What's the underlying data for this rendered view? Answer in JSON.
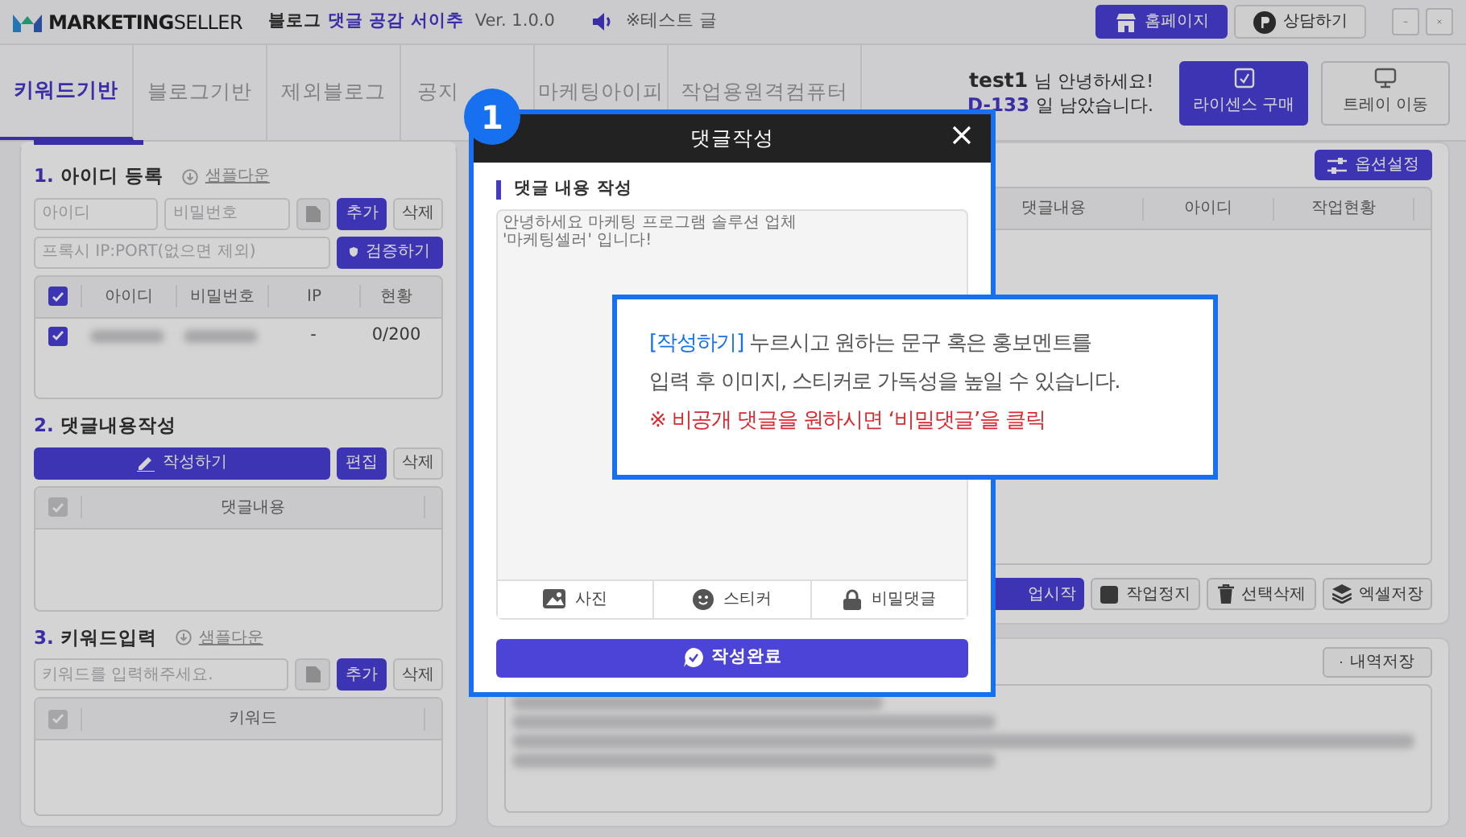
{
  "app": {
    "logo": "**MARKETING**SELLER",
    "product_prefix": "블로그",
    "product_name": "댓글 공감 서이추",
    "version": "Ver. 1.0.0",
    "notice": "※테스트 글"
  },
  "header_buttons": [
    {
      "label": "홈페이지",
      "kind": "home"
    },
    {
      "label": "상담하기",
      "kind": "chat"
    }
  ],
  "tabs": [
    {
      "label": "키워드기반",
      "selected": true
    },
    {
      "label": "블로그기반",
      "selected": false
    },
    {
      "label": "제외블로그",
      "selected": false
    },
    {
      "label": "공지",
      "selected": false
    },
    {
      "label": "마케팅아이피",
      "selected": false
    },
    {
      "label": "작업용원격컴퓨터",
      "selected": false
    }
  ],
  "user": {
    "name": "test1",
    "greeting": "님 안녕하세요!",
    "days": "D-133",
    "days_suffix": "일 남았습니다."
  },
  "side_buttons": [
    {
      "label": "라이센스 구매",
      "kind": "license"
    },
    {
      "label": "트레이 이동",
      "kind": "tray"
    }
  ],
  "account_section": {
    "number": "1.",
    "title": "아이디 등록",
    "link": "샘플다운",
    "id_placeholder": "아이디",
    "password_placeholder": "비밀번호",
    "add": "추가",
    "delete": "삭제",
    "proxy_placeholder": "프록시 IP:PORT(없으면 제외)",
    "verify": "검증하기",
    "header_checked": true,
    "columns": [
      "아이디",
      "비밀번호",
      "IP",
      "현황"
    ],
    "rows": [
      {
        "checked": true,
        "ip": "-",
        "status": "0/200"
      }
    ]
  },
  "comment_section": {
    "number": "2.",
    "title": "댓글내용작성",
    "write": "작성하기",
    "edit": "편집",
    "delete": "삭제",
    "header_checked": true,
    "column": "댓글내용"
  },
  "keyword_section": {
    "number": "3.",
    "title": "키워드입력",
    "link": "샘플다운",
    "placeholder": "키워드를 입력해주세요.",
    "add": "추가",
    "delete": "삭제",
    "header_checked": true,
    "column": "키워드"
  },
  "task_panel": {
    "options": "옵션설정",
    "columns": [
      "댓글내용",
      "아이디",
      "작업현황"
    ],
    "actions": [
      {
        "label": "업시작",
        "kind": "start"
      },
      {
        "label": "작업정지",
        "kind": "stop"
      },
      {
        "label": "선택삭제",
        "kind": "trash"
      },
      {
        "label": "엑셀저장",
        "kind": "excel"
      }
    ]
  },
  "log_panel": {
    "save": "내역저장"
  },
  "modal": {
    "title": "댓글작성",
    "section": "댓글 내용 작성",
    "placeholder": "안녕하세요 마케팅 프로그램 솔루션 업체\n'마케팅셀러' 입니다!",
    "tools": [
      {
        "label": "사진",
        "kind": "photo"
      },
      {
        "label": "스티커",
        "kind": "sticker"
      },
      {
        "label": "비밀댓글",
        "kind": "lock"
      }
    ],
    "submit": "작성완료"
  },
  "step_badge": "1",
  "callout": {
    "highlight": "[작성하기]",
    "lines": [
      "누르시고 원하는 문구 혹은 홍보멘트를",
      "입력 후 이미지, 스티커로 가독성을 높일 수 있습니다."
    ],
    "warning": "※ 비공개 댓글을 원하시면 ‘비밀댓글’을 클릭"
  }
}
